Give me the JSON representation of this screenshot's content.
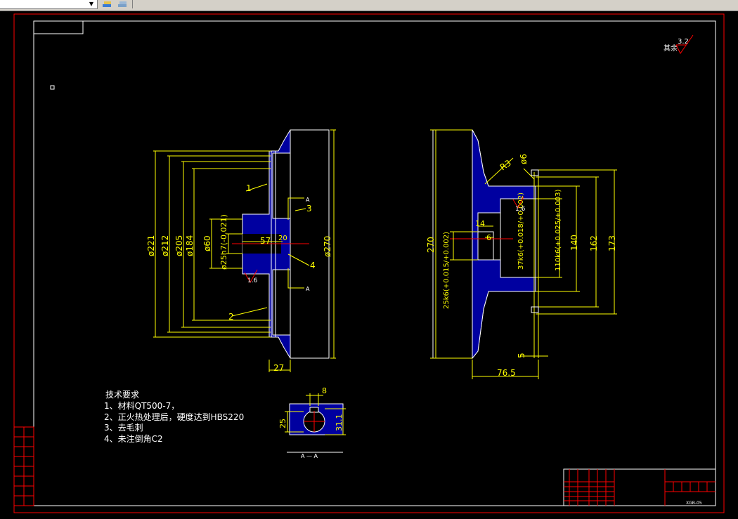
{
  "toolbar": {
    "layer_dropdown_value": "",
    "icons": [
      "layer-state-icon",
      "layer-previous-icon"
    ]
  },
  "drawing": {
    "roughness_general_label": "其余",
    "roughness_general_value": "3.2",
    "left_view": {
      "dims": [
        "ø221",
        "ø212",
        "ø205",
        "ø184",
        "ø60",
        "ø25h7(-0.021)",
        "57",
        "20",
        "ø270",
        "27"
      ],
      "roughness": "1.6",
      "balloons": [
        "1",
        "2",
        "3",
        "4"
      ],
      "section_mark": "A"
    },
    "right_view": {
      "dims": [
        "270",
        "R3",
        "ø6",
        "14",
        "6",
        "25k6(+0.015/+0.002)",
        "37k6(+0.018/+0.002)",
        "110k6(+0.025/+0.003)",
        "140",
        "162",
        "173",
        "5",
        "76.5"
      ],
      "roughness": "1.6"
    },
    "section_view": {
      "dims": [
        "8",
        "25",
        "31.1"
      ],
      "label": "A — A"
    },
    "tech_requirements": {
      "title": "技术要求",
      "items": [
        "1、材料QT500-7，",
        "2、正火热处理后，硬度达到HBS220",
        "3、去毛刺",
        "4、未注倒角C2"
      ]
    },
    "title_block": {
      "drawing_no": "XGB-05"
    }
  }
}
